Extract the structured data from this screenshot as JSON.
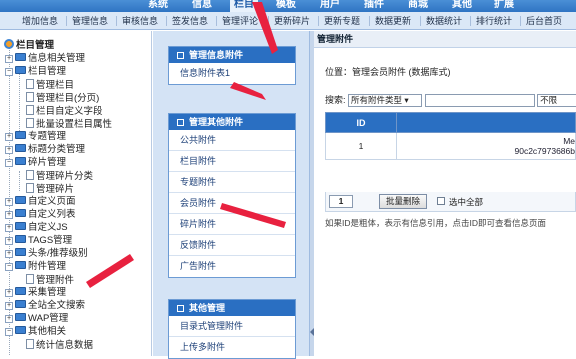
{
  "topnav": {
    "items": [
      {
        "label": "系统"
      },
      {
        "label": "信息"
      },
      {
        "label": "栏目"
      },
      {
        "label": "模板"
      },
      {
        "label": "用户"
      },
      {
        "label": "插件"
      },
      {
        "label": "商城"
      },
      {
        "label": "其他"
      },
      {
        "label": "扩展"
      }
    ]
  },
  "subnav": {
    "items": [
      {
        "label": "增加信息"
      },
      {
        "label": "管理信息"
      },
      {
        "label": "审核信息"
      },
      {
        "label": "签发信息"
      },
      {
        "label": "管理评论"
      },
      {
        "label": "更新碎片"
      },
      {
        "label": "更新专题"
      },
      {
        "label": "数据更新"
      },
      {
        "label": "数据统计"
      },
      {
        "label": "排行统计"
      },
      {
        "label": "后台首页"
      }
    ]
  },
  "tree": {
    "root": "栏目管理",
    "nodes": [
      {
        "label": "信息相关管理"
      },
      {
        "label": "栏目管理"
      },
      {
        "label": "管理栏目"
      },
      {
        "label": "管理栏目(分页)"
      },
      {
        "label": "栏目自定义字段"
      },
      {
        "label": "批量设置栏目属性"
      },
      {
        "label": "专题管理"
      },
      {
        "label": "标题分类管理"
      },
      {
        "label": "碎片管理"
      },
      {
        "label": "管理碎片分类"
      },
      {
        "label": "管理碎片"
      },
      {
        "label": "自定义页面"
      },
      {
        "label": "自定义列表"
      },
      {
        "label": "自定义JS"
      },
      {
        "label": "TAGS管理"
      },
      {
        "label": "头条/推荐级别"
      },
      {
        "label": "附件管理"
      },
      {
        "label": "管理附件"
      },
      {
        "label": "采集管理"
      },
      {
        "label": "全站全文搜索"
      },
      {
        "label": "WAP管理"
      },
      {
        "label": "其他相关"
      },
      {
        "label": "统计信息数据"
      }
    ]
  },
  "menu": {
    "box1": {
      "title": "管理信息附件",
      "items": [
        {
          "label": "信息附件表1"
        }
      ]
    },
    "box2": {
      "title": "管理其他附件",
      "items": [
        {
          "label": "公共附件"
        },
        {
          "label": "栏目附件"
        },
        {
          "label": "专题附件"
        },
        {
          "label": "会员附件"
        },
        {
          "label": "碎片附件"
        },
        {
          "label": "反馈附件"
        },
        {
          "label": "广告附件"
        }
      ]
    },
    "box3": {
      "title": "其他管理",
      "items": [
        {
          "label": "目录式管理附件"
        },
        {
          "label": "上传多附件"
        }
      ]
    }
  },
  "content": {
    "title": "管理附件",
    "location": "位置：管理会员附件 (数据库式)",
    "search": {
      "label": "搜索:",
      "type_select": "所有附件类型",
      "limit_select": "不限"
    },
    "table": {
      "headers": [
        "ID",
        ""
      ],
      "rows": [
        {
          "id": "1",
          "name_line1": "Me",
          "name_line2": "90c2c7973686b"
        }
      ]
    },
    "page_input": "1",
    "batch_delete": "批量删除",
    "select_all": "选中全部",
    "note": "如果ID是粗体，表示有信息引用，点击ID即可查看信息页面"
  },
  "colors": {
    "header": "#2f74c3",
    "panel_head": "#2a6fc2",
    "annotation_arrow": "#e8213f"
  }
}
